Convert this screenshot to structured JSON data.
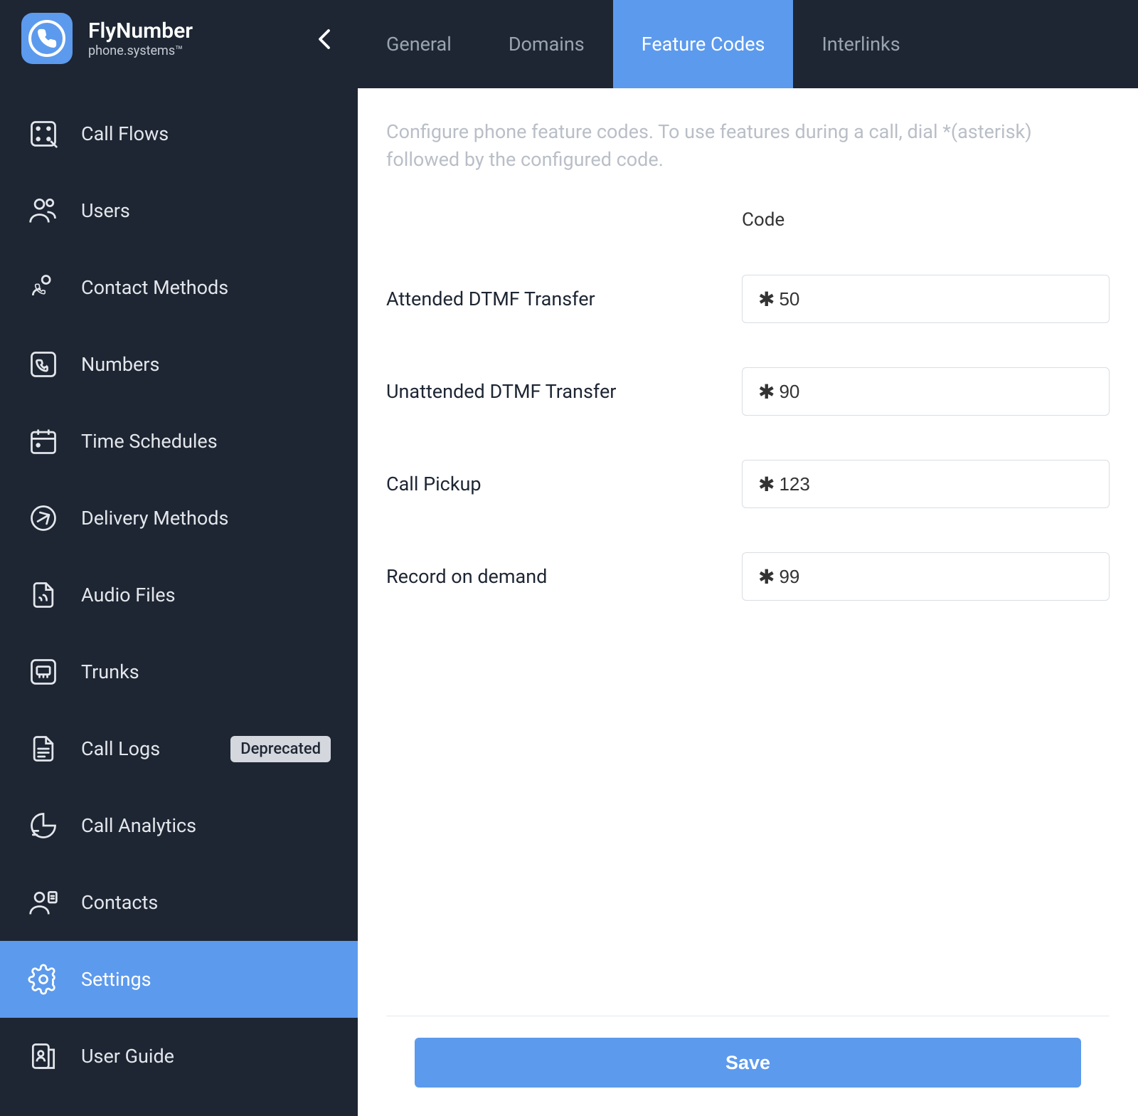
{
  "header": {
    "title": "FlyNumber",
    "subtitle": "phone.systems™"
  },
  "sidebar": {
    "items": [
      {
        "label": "Call Flows"
      },
      {
        "label": "Users"
      },
      {
        "label": "Contact Methods"
      },
      {
        "label": "Numbers"
      },
      {
        "label": "Time Schedules"
      },
      {
        "label": "Delivery Methods"
      },
      {
        "label": "Audio Files"
      },
      {
        "label": "Trunks"
      },
      {
        "label": "Call Logs",
        "badge": "Deprecated"
      },
      {
        "label": "Call Analytics"
      },
      {
        "label": "Contacts"
      },
      {
        "label": "Settings"
      },
      {
        "label": "User Guide"
      }
    ]
  },
  "tabs": [
    {
      "label": "General"
    },
    {
      "label": "Domains"
    },
    {
      "label": "Feature Codes"
    },
    {
      "label": "Interlinks"
    }
  ],
  "content": {
    "description": "Configure phone feature codes. To use features during a call, dial *(asterisk) followed by the configured code.",
    "codeHeader": "Code",
    "rows": [
      {
        "label": "Attended DTMF Transfer",
        "value": "50"
      },
      {
        "label": "Unattended DTMF Transfer",
        "value": "90"
      },
      {
        "label": "Call Pickup",
        "value": "123"
      },
      {
        "label": "Record on demand",
        "value": "99"
      }
    ]
  },
  "footer": {
    "saveLabel": "Save"
  }
}
